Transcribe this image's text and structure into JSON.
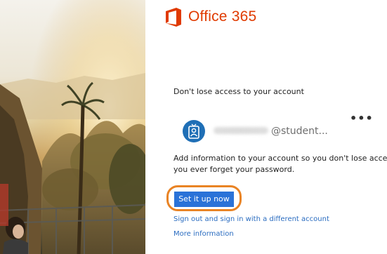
{
  "brand": {
    "name": "Office 365",
    "color": "#e03a00"
  },
  "prompt": {
    "heading": "Don't lose access to your account",
    "account_suffix": "@student...",
    "more_menu": "•••",
    "message_line1": "Add information to your account so you don't lose access if",
    "message_line2": "you ever forget your password."
  },
  "actions": {
    "setup_button": "Set it up now",
    "signout_link": "Sign out and sign in with a different account",
    "more_info_link": "More information"
  },
  "colors": {
    "button_bg": "#2a72d8",
    "highlight_ring": "#e98324",
    "link": "#2a6cc0",
    "avatar_bg": "#1f6fb6"
  },
  "icons": {
    "brand_logo": "office-logo-icon",
    "avatar": "id-badge-icon",
    "more": "ellipsis-icon"
  }
}
